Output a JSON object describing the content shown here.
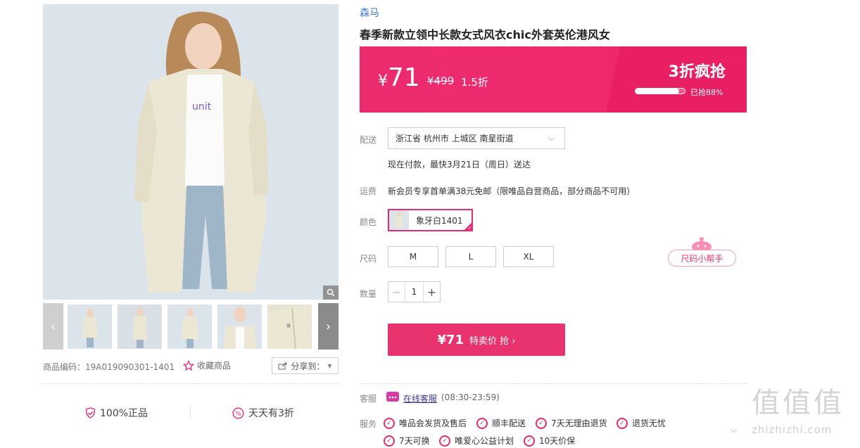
{
  "gallery": {
    "prev_arrow": "‹",
    "next_arrow": "›",
    "main_image": {
      "background": "#dbe4ea",
      "coat_color": "#ece7d4",
      "jeans_color": "#9fb5c8",
      "shirt_text": "unit",
      "shirt_text_color": "#7a5cc8"
    }
  },
  "meta": {
    "sku": "商品编码：19A019090301-1401",
    "favorite": "收藏商品",
    "share": "分享到："
  },
  "guarantees": [
    {
      "icon": "shield-icon",
      "label": "100%正品"
    },
    {
      "icon": "discount-icon",
      "label": "天天有3折"
    }
  ],
  "product": {
    "brand": "森马",
    "title": "春季新款立领中长款女式风衣chic外套英伦港风女"
  },
  "price": {
    "currency": "¥",
    "amount": "71",
    "original": "¥499",
    "discount": "1.5折",
    "flash_title": "3折疯抢",
    "progress_text": "已抢88%",
    "progress": 0.88,
    "accent_color": "#ec2b6f"
  },
  "delivery": {
    "label": "配送",
    "address": "浙江省 杭州市 上城区 南星街道",
    "eta": "现在付款，最快3月21日（周日）送达"
  },
  "shipping": {
    "label": "运费",
    "text": "新会员专享首单满38元免邮（限唯品自营商品，部分商品不可用）"
  },
  "color": {
    "label": "颜色",
    "selected": "象牙白1401"
  },
  "size": {
    "label": "尺码",
    "options": [
      "M",
      "L",
      "XL"
    ],
    "helper": "尺码小帮手"
  },
  "quantity": {
    "label": "数量",
    "minus": "−",
    "value": "1",
    "plus": "+"
  },
  "buy": {
    "price": "¥71",
    "label": "特卖价 抢 ›",
    "color": "#e8336f"
  },
  "customer_service": {
    "label": "客服",
    "link": "在线客服",
    "hours": "(08:30-23:59)"
  },
  "services": {
    "label": "服务",
    "items": [
      "唯品会发货及售后",
      "顺丰配送",
      "7天无理由退货",
      "退货无忧",
      "7天可换",
      "唯爱心公益计划",
      "10天价保"
    ]
  },
  "watermark": {
    "glyphs": "值值值",
    "url": "zhizhizhi.com"
  }
}
